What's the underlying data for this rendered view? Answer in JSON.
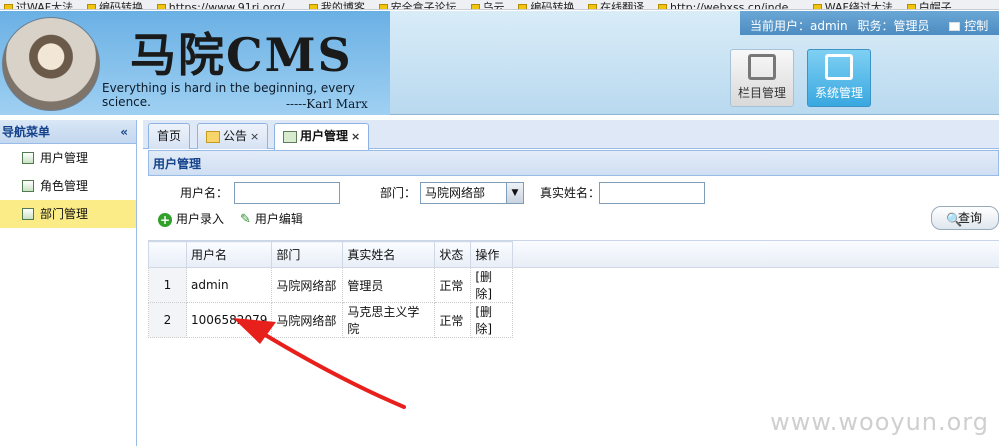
{
  "bookmarks": [
    "过WAF大法",
    "编码转换",
    "https://www.91ri.org/...",
    "我的博客",
    "安全盒子论坛",
    "乌云",
    "编码转换",
    "在线翻译",
    "http://webxss.cn/inde...",
    "WAF绕过大法",
    "白帽子"
  ],
  "header": {
    "logo_title": "马院CMS",
    "motto": "Everything is hard in the beginning, every science.",
    "author": "-----Karl Marx",
    "current_user_label": "当前用户：admin",
    "role_label": "职务：管理员",
    "control_label": "控制"
  },
  "tiles": {
    "column_manage": "栏目管理",
    "system_manage": "系统管理"
  },
  "sidebar": {
    "title": "导航菜单",
    "collapse": "«",
    "items": [
      {
        "label": "用户管理"
      },
      {
        "label": "角色管理"
      },
      {
        "label": "部门管理"
      }
    ]
  },
  "tabs": [
    {
      "label": "首页"
    },
    {
      "label": "公告",
      "close": "×"
    },
    {
      "label": "用户管理",
      "close": "×"
    }
  ],
  "panel_title": "用户管理",
  "filters": {
    "username_label": "用户名：",
    "dept_label": "部门：",
    "dept_value": "马院网络部",
    "realname_label": "真实姓名：",
    "dropdown_glyph": "▼"
  },
  "actions": {
    "add": "用户录入",
    "edit": "用户编辑",
    "query": "查询"
  },
  "grid": {
    "headers": [
      "用户名",
      "部门",
      "真实姓名",
      "状态",
      "操作"
    ],
    "rows": [
      {
        "n": "1",
        "username": "admin",
        "dept": "马院网络部",
        "realname": "管理员",
        "status": "正常",
        "op": "[删除]"
      },
      {
        "n": "2",
        "username": "1006582079",
        "dept": "马院网络部",
        "realname": "马克思主义学院",
        "status": "正常",
        "op": "[删除]"
      }
    ]
  },
  "watermark": "www.wooyun.org",
  "colors": {
    "arrow": "#e8201c",
    "selected_nav": "#fbec88",
    "header_bg": "#b9d9ef"
  }
}
